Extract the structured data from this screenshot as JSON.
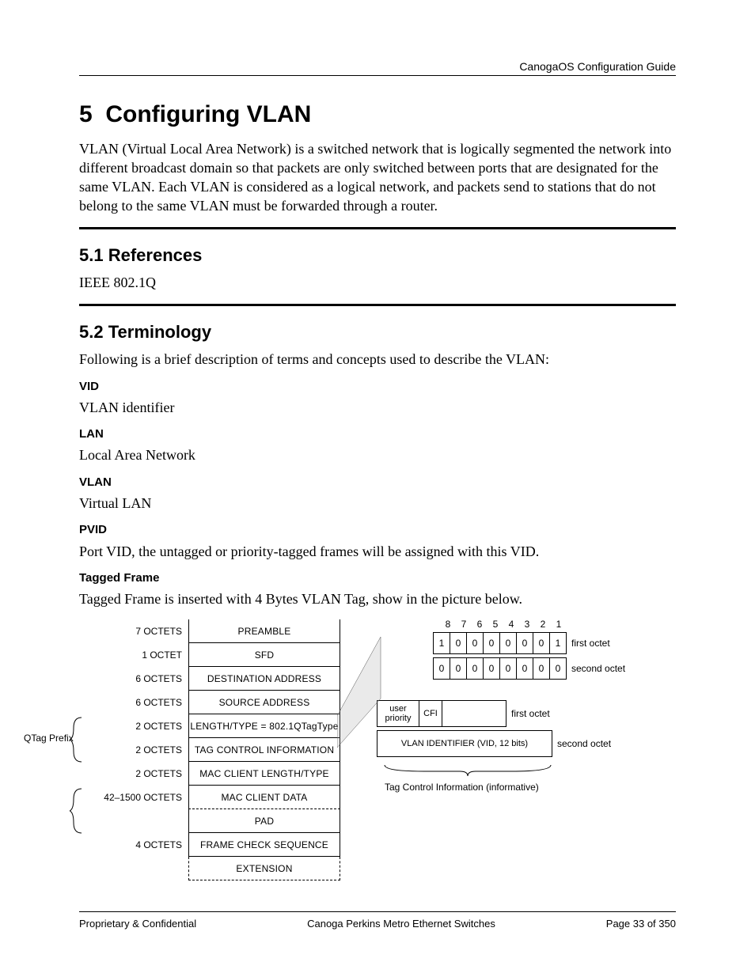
{
  "header": {
    "right": "CanogaOS Configuration Guide"
  },
  "h1_number": "5",
  "h1_title": "Configuring VLAN",
  "intro": "VLAN (Virtual Local Area Network) is a switched network that is logically segmented the network into different broadcast domain so that packets are only switched between ports that are designated for the same VLAN. Each VLAN is considered as a logical network, and packets send to stations that do not belong to the same VLAN must be forwarded through a router.",
  "s1_number": "5.1",
  "s1_title": "References",
  "s1_body": "IEEE 802.1Q",
  "s2_number": "5.2",
  "s2_title": "Terminology",
  "s2_intro": "Following is a brief description of terms and concepts used to describe the VLAN:",
  "terms": {
    "vid_h": "VID",
    "vid_b": "VLAN identifier",
    "lan_h": "LAN",
    "lan_b": "Local Area Network",
    "vlan_h": "VLAN",
    "vlan_b": "Virtual LAN",
    "pvid_h": "PVID",
    "pvid_b": "Port VID, the untagged or priority-tagged frames will be assigned with this VID.",
    "tf_h": "Tagged Frame",
    "tf_b": "Tagged Frame is inserted with 4 Bytes VLAN Tag, show in the picture below."
  },
  "diagram": {
    "qtag_label": "QTag Prefix",
    "rows": [
      {
        "oct": "7 OCTETS",
        "field": "PREAMBLE"
      },
      {
        "oct": "1 OCTET",
        "field": "SFD"
      },
      {
        "oct": "6 OCTETS",
        "field": "DESTINATION ADDRESS"
      },
      {
        "oct": "6 OCTETS",
        "field": "SOURCE ADDRESS"
      },
      {
        "oct": "2 OCTETS",
        "field": "LENGTH/TYPE = 802.1QTagType"
      },
      {
        "oct": "2 OCTETS",
        "field": "TAG CONTROL INFORMATION"
      },
      {
        "oct": "2 OCTETS",
        "field": "MAC CLIENT LENGTH/TYPE"
      },
      {
        "oct": "42–1500 OCTETS",
        "field": "MAC CLIENT DATA"
      },
      {
        "oct": "",
        "field": "PAD"
      },
      {
        "oct": "4 OCTETS",
        "field": "FRAME CHECK SEQUENCE"
      },
      {
        "oct": "",
        "field": "EXTENSION"
      }
    ],
    "bits": [
      "8",
      "7",
      "6",
      "5",
      "4",
      "3",
      "2",
      "1"
    ],
    "first_octet_bits": [
      "1",
      "0",
      "0",
      "0",
      "0",
      "0",
      "0",
      "1"
    ],
    "second_octet_bits": [
      "0",
      "0",
      "0",
      "0",
      "0",
      "0",
      "0",
      "0"
    ],
    "first_octet_label": "first octet",
    "second_octet_label": "second octet",
    "tag_up": "user priority",
    "tag_cfi": "CFI",
    "tag_vid": "VLAN IDENTIFIER (VID, 12 bits)",
    "tag_first_label": "first octet",
    "tag_second_label": "second octet",
    "tci_note": "Tag Control Information (informative)"
  },
  "footer": {
    "left": "Proprietary & Confidential",
    "center": "Canoga Perkins Metro Ethernet Switches",
    "right": "Page 33 of 350"
  }
}
